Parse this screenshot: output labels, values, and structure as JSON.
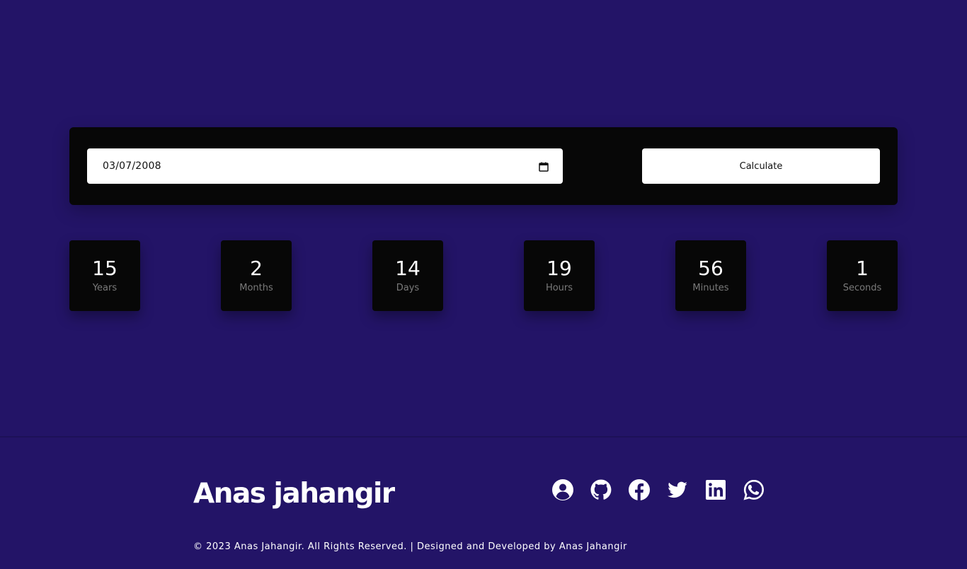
{
  "calculator": {
    "date_value": "03/07/2008",
    "calendar_icon": "calendar-icon",
    "calculate_label": "Calculate"
  },
  "results": [
    {
      "value": "15",
      "label": "Years"
    },
    {
      "value": "2",
      "label": "Months"
    },
    {
      "value": "14",
      "label": "Days"
    },
    {
      "value": "19",
      "label": "Hours"
    },
    {
      "value": "56",
      "label": "Minutes"
    },
    {
      "value": "1",
      "label": "Seconds"
    }
  ],
  "footer": {
    "name": "Anas jahangir",
    "copyright": "© 2023 Anas Jahangir. All Rights Reserved. | Designed and Developed by Anas Jahangir",
    "social_icons": [
      "user-circle-icon",
      "github-icon",
      "facebook-icon",
      "twitter-icon",
      "linkedin-icon",
      "whatsapp-icon"
    ]
  },
  "colors": {
    "background": "#231467",
    "panel": "#070707",
    "label_gray": "#7a7a7a",
    "text_white": "#ffffff"
  }
}
